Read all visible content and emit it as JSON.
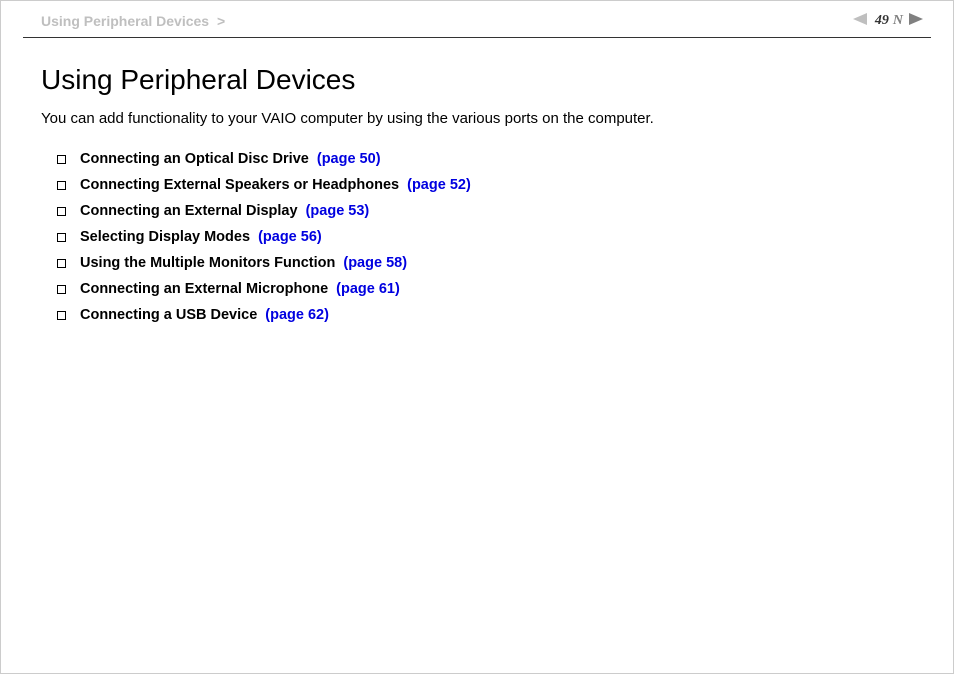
{
  "header": {
    "breadcrumb": "Using Peripheral Devices",
    "sep": ">",
    "page": "49",
    "n": "N"
  },
  "main": {
    "title": "Using Peripheral Devices",
    "intro": "You can add functionality to your VAIO computer by using the various ports on the computer."
  },
  "toc": [
    {
      "label": "Connecting an Optical Disc Drive",
      "page": "(page 50)"
    },
    {
      "label": "Connecting External Speakers or Headphones",
      "page": "(page 52)"
    },
    {
      "label": "Connecting an External Display",
      "page": "(page 53)"
    },
    {
      "label": "Selecting Display Modes",
      "page": "(page 56)"
    },
    {
      "label": "Using the Multiple Monitors Function",
      "page": "(page 58)"
    },
    {
      "label": "Connecting an External Microphone",
      "page": "(page 61)"
    },
    {
      "label": "Connecting a USB Device",
      "page": "(page 62)"
    }
  ]
}
